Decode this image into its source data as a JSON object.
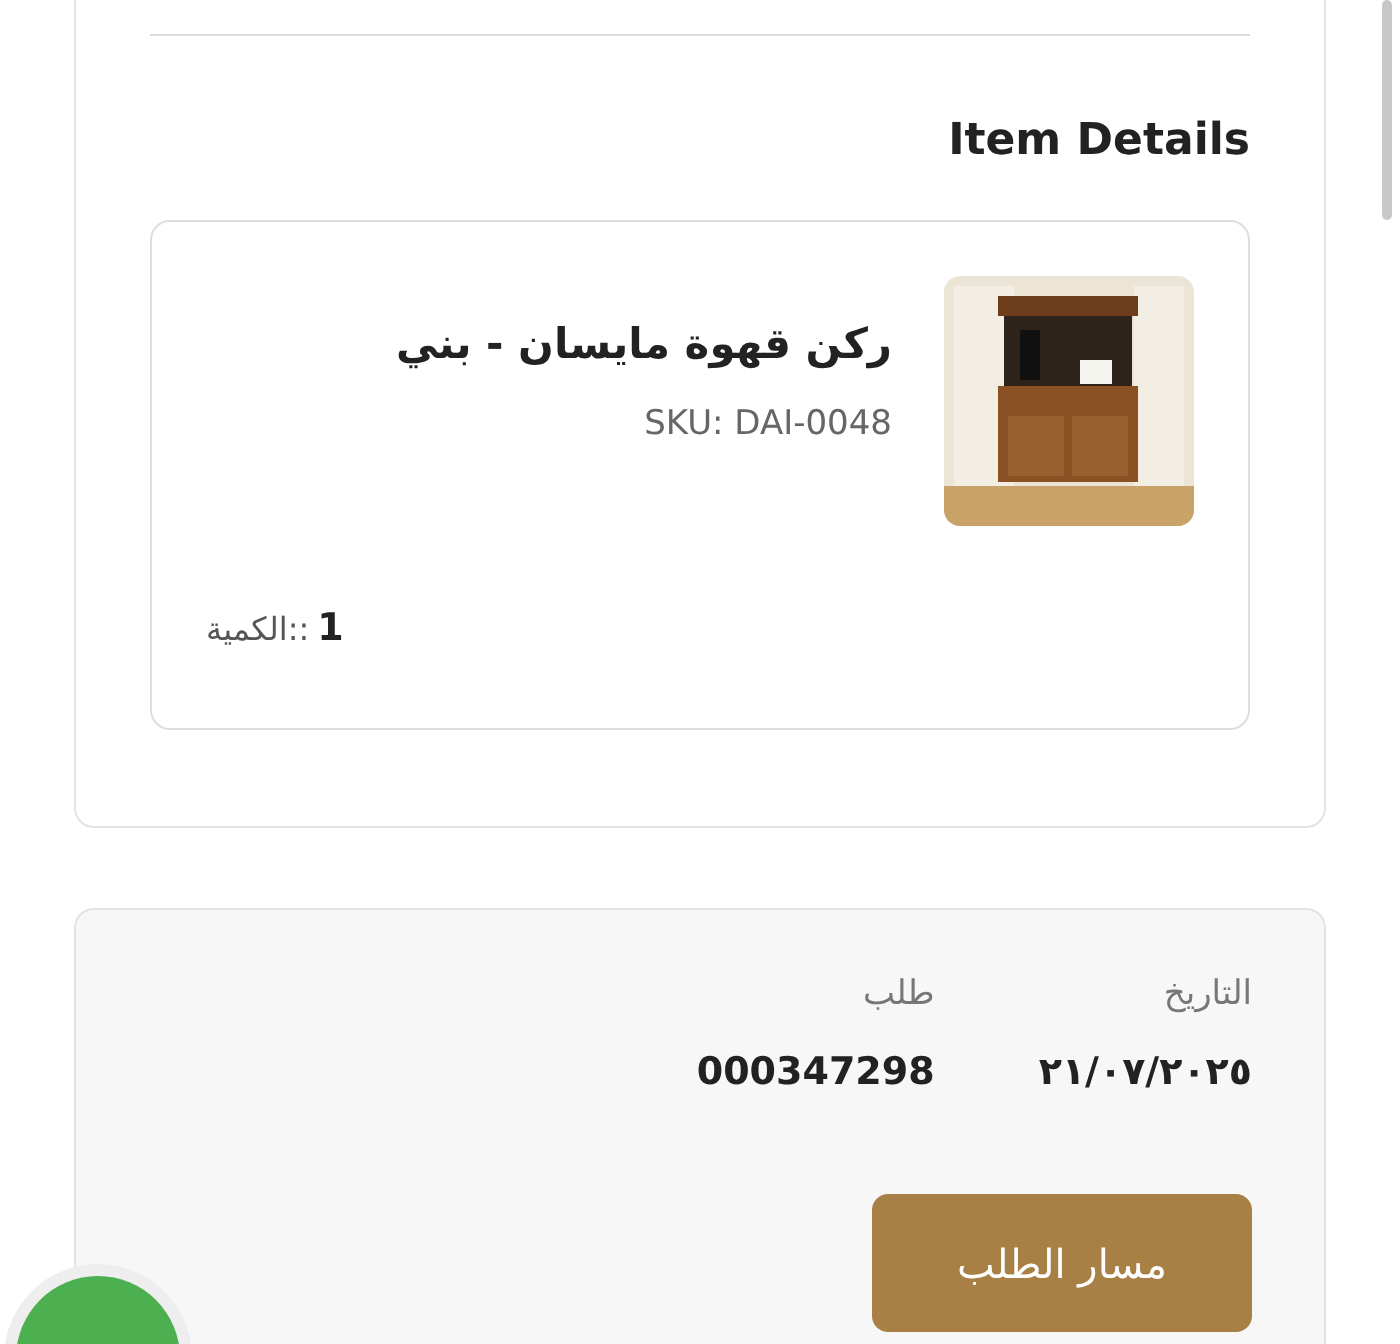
{
  "section_title": "Item Details",
  "item": {
    "name": "ركن قهوة مايسان - بني",
    "sku": "SKU: DAI-0048",
    "quantity_label": "الكمية::",
    "quantity": "1"
  },
  "order": {
    "fields": [
      {
        "label": "التاريخ",
        "value": "٢١/٠٧/٢٠٢٥"
      },
      {
        "label": "طلب",
        "value": "000347298"
      }
    ],
    "button": "مسار الطلب"
  }
}
